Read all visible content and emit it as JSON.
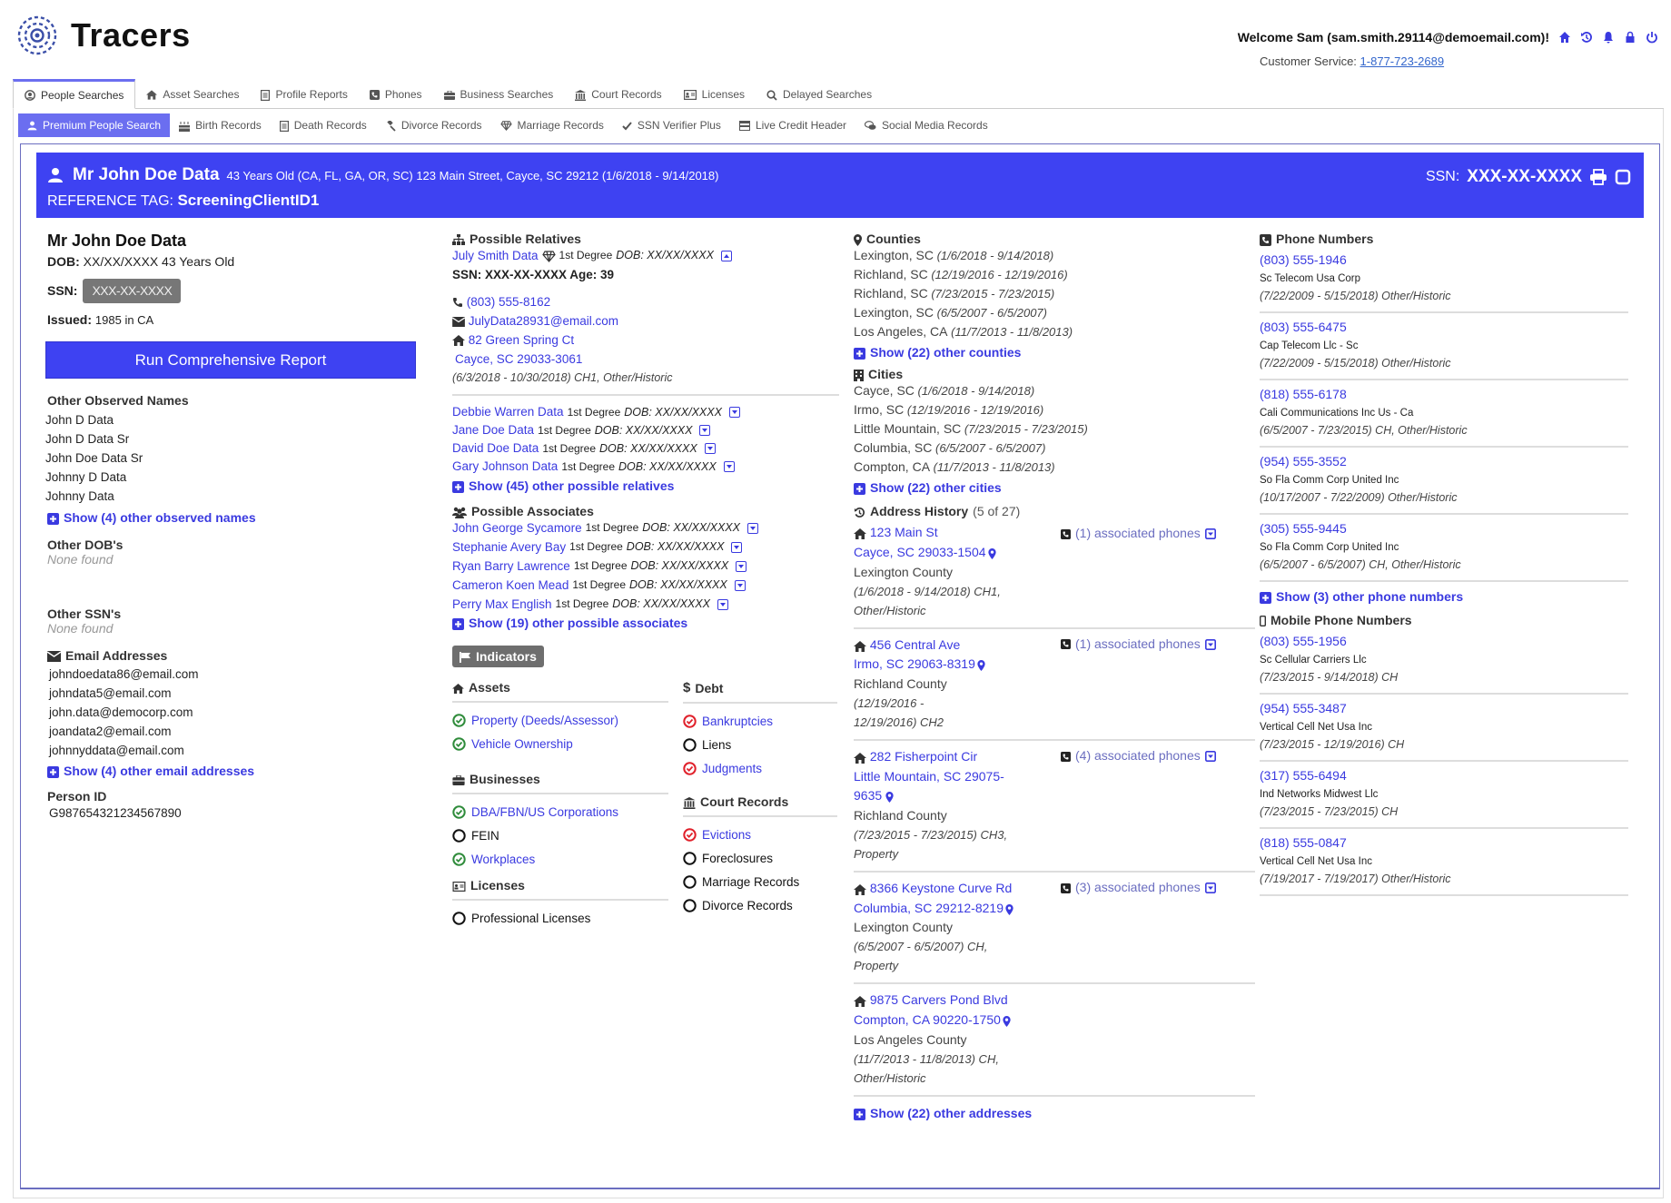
{
  "app": {
    "logo_text": "Tracers",
    "welcome": "Welcome Sam (sam.smith.29114@demoemail.com)!",
    "header_icons": [
      "home-icon",
      "history-icon",
      "bell-icon",
      "lock-icon",
      "power-icon"
    ],
    "customer_service_label": "Customer Service:",
    "customer_service_phone": "1-877-723-2689",
    "accent_color": "#3e42f2"
  },
  "tabs": [
    {
      "label": "People Searches",
      "icon": "user-circle-icon",
      "active": true
    },
    {
      "label": "Asset Searches",
      "icon": "home-icon"
    },
    {
      "label": "Profile Reports",
      "icon": "document-icon"
    },
    {
      "label": "Phones",
      "icon": "phone-square-icon"
    },
    {
      "label": "Business Searches",
      "icon": "briefcase-icon"
    },
    {
      "label": "Court Records",
      "icon": "bank-icon"
    },
    {
      "label": "Licenses",
      "icon": "id-card-icon"
    },
    {
      "label": "Delayed Searches",
      "icon": "search-icon"
    }
  ],
  "subtabs": [
    {
      "label": "Premium People Search",
      "icon": "user-icon",
      "active": true
    },
    {
      "label": "Birth Records",
      "icon": "birthday-cake-icon"
    },
    {
      "label": "Death Records",
      "icon": "document-icon"
    },
    {
      "label": "Divorce Records",
      "icon": "gavel-icon"
    },
    {
      "label": "Marriage Records",
      "icon": "diamond-icon"
    },
    {
      "label": "SSN Verifier Plus",
      "icon": "check-icon"
    },
    {
      "label": "Live Credit Header",
      "icon": "credit-card-icon"
    },
    {
      "label": "Social Media Records",
      "icon": "comments-icon"
    }
  ],
  "banner": {
    "name": "Mr John Doe Data",
    "summary": "43 Years Old (CA, FL, GA, OR, SC) 123 Main Street, Cayce, SC 29212 (1/6/2018 - 9/14/2018)",
    "ref_label": "REFERENCE TAG:",
    "ref_value": "ScreeningClientID1",
    "ssn_label": "SSN:",
    "ssn_value": "XXX-XX-XXXX"
  },
  "person": {
    "name": "Mr John Doe Data",
    "dob_label": "DOB:",
    "dob_value": "XX/XX/XXXX 43 Years Old",
    "ssn_label": "SSN:",
    "ssn_value": "XXX-XX-XXXX",
    "issued_label": "Issued:",
    "issued_value": "1985 in CA",
    "run_report_label": "Run Comprehensive Report",
    "other_names_title": "Other Observed Names",
    "other_names": [
      "John D Data",
      "John D Data Sr",
      "John Doe Data Sr",
      "Johnny D Data",
      "Johnny Data"
    ],
    "show_names": "Show (4) other observed names",
    "other_dobs_title": "Other DOB's",
    "other_dobs_value": "None found",
    "other_ssns_title": "Other SSN's",
    "other_ssns_value": "None found",
    "emails_title": "Email Addresses",
    "emails": [
      "johndoedata86@email.com",
      "johndata5@email.com",
      "john.data@democorp.com",
      "joandata2@email.com",
      "johnnyddata@email.com"
    ],
    "show_emails": "Show (4) other email addresses",
    "person_id_title": "Person ID",
    "person_id": "G987654321234567890"
  },
  "relatives": {
    "title": "Possible Relatives",
    "expanded": {
      "name": "July Smith Data",
      "degree": "1st Degree",
      "dob_label": "DOB:",
      "dob_value": "XX/XX/XXXX",
      "ssn_age": "SSN: XXX-XX-XXXX Age: 39",
      "phone": "(803) 555-8162",
      "email": "JulyData28931@email.com",
      "street": "82 Green Spring Ct",
      "city": "Cayce, SC 29033-3061",
      "dates": "(6/3/2018 - 10/30/2018) CH1, Other/Historic"
    },
    "items": [
      {
        "name": "Debbie Warren Data",
        "degree": "1st Degree",
        "dob_label": "DOB:",
        "dob_value": "XX/XX/XXXX"
      },
      {
        "name": "Jane Doe Data",
        "degree": "1st Degree",
        "dob_label": "DOB:",
        "dob_value": "XX/XX/XXXX"
      },
      {
        "name": "David Doe Data",
        "degree": "1st Degree",
        "dob_label": "DOB:",
        "dob_value": "XX/XX/XXXX"
      },
      {
        "name": "Gary Johnson Data",
        "degree": "1st Degree",
        "dob_label": "DOB:",
        "dob_value": "XX/XX/XXXX"
      }
    ],
    "show_more": "Show (45) other possible relatives"
  },
  "associates": {
    "title": "Possible Associates",
    "items": [
      {
        "name": "John George Sycamore",
        "degree": "1st Degree",
        "dob_label": "DOB:",
        "dob_value": "XX/XX/XXXX"
      },
      {
        "name": "Stephanie Avery Bay",
        "degree": "1st Degree",
        "dob_label": "DOB:",
        "dob_value": "XX/XX/XXXX"
      },
      {
        "name": "Ryan Barry Lawrence",
        "degree": "1st Degree",
        "dob_label": "DOB:",
        "dob_value": "XX/XX/XXXX"
      },
      {
        "name": "Cameron Koen Mead",
        "degree": "1st Degree",
        "dob_label": "DOB:",
        "dob_value": "XX/XX/XXXX"
      },
      {
        "name": "Perry Max English",
        "degree": "1st Degree",
        "dob_label": "DOB:",
        "dob_value": "XX/XX/XXXX"
      }
    ],
    "show_more": "Show (19) other possible associates"
  },
  "indicators": {
    "button_label": "Indicators",
    "status_colors": {
      "found": "#2e8b3a",
      "alert": "#e0202a",
      "none": "#111111"
    },
    "assets": {
      "title": "Assets",
      "items": [
        {
          "label": "Property (Deeds/Assessor)",
          "status": "found"
        },
        {
          "label": "Vehicle Ownership",
          "status": "found"
        }
      ]
    },
    "businesses": {
      "title": "Businesses",
      "items": [
        {
          "label": "DBA/FBN/US Corporations",
          "status": "found"
        },
        {
          "label": "FEIN",
          "status": "none"
        },
        {
          "label": "Workplaces",
          "status": "found"
        }
      ]
    },
    "licenses": {
      "title": "Licenses",
      "items": [
        {
          "label": "Professional Licenses",
          "status": "none"
        }
      ]
    },
    "debt": {
      "title": "Debt",
      "items": [
        {
          "label": "Bankruptcies",
          "status": "alert"
        },
        {
          "label": "Liens",
          "status": "none"
        },
        {
          "label": "Judgments",
          "status": "alert"
        }
      ]
    },
    "court": {
      "title": "Court Records",
      "items": [
        {
          "label": "Evictions",
          "status": "alert"
        },
        {
          "label": "Foreclosures",
          "status": "none"
        },
        {
          "label": "Marriage Records",
          "status": "none"
        },
        {
          "label": "Divorce Records",
          "status": "none"
        }
      ]
    }
  },
  "counties": {
    "title": "Counties",
    "items": [
      {
        "place": "Lexington, SC",
        "dates": "(1/6/2018 - 9/14/2018)"
      },
      {
        "place": "Richland, SC",
        "dates": "(12/19/2016 - 12/19/2016)"
      },
      {
        "place": "Richland, SC",
        "dates": "(7/23/2015 - 7/23/2015)"
      },
      {
        "place": "Lexington, SC",
        "dates": "(6/5/2007 - 6/5/2007)"
      },
      {
        "place": "Los Angeles, CA",
        "dates": "(11/7/2013 - 11/8/2013)"
      }
    ],
    "show_more": "Show (22) other counties"
  },
  "cities": {
    "title": "Cities",
    "items": [
      {
        "place": "Cayce, SC",
        "dates": "(1/6/2018 - 9/14/2018)"
      },
      {
        "place": "Irmo, SC",
        "dates": "(12/19/2016 - 12/19/2016)"
      },
      {
        "place": "Little Mountain, SC",
        "dates": "(7/23/2015 - 7/23/2015)"
      },
      {
        "place": "Columbia, SC",
        "dates": "(6/5/2007 - 6/5/2007)"
      },
      {
        "place": "Compton, CA",
        "dates": "(11/7/2013 - 11/8/2013)"
      }
    ],
    "show_more": "Show (22) other cities"
  },
  "addresses": {
    "title": "Address History",
    "count": "(5 of 27)",
    "items": [
      {
        "street": "123 Main St",
        "city": "Cayce, SC 29033-1504",
        "county": "Lexington County",
        "dates": "(1/6/2018 - 9/14/2018) CH1,",
        "type": "Other/Historic",
        "phones": "(1) associated phones"
      },
      {
        "street": "456 Central Ave",
        "city": "Irmo, SC 29063-8319",
        "county": "Richland County",
        "dates": "(12/19/2016 -",
        "type": "12/19/2016) CH2",
        "phones": "(1) associated phones"
      },
      {
        "street": "282 Fisherpoint Cir",
        "city": "Little Mountain, SC 29075-",
        "city2": "9635",
        "county": "Richland County",
        "dates": "(7/23/2015 - 7/23/2015) CH3,",
        "type": "Property",
        "phones": "(4) associated phones"
      },
      {
        "street": "8366 Keystone Curve Rd",
        "city": "Columbia, SC 29212-8219",
        "county": "Lexington County",
        "dates": "(6/5/2007 - 6/5/2007) CH,",
        "type": "Property",
        "phones": "(3) associated phones"
      },
      {
        "street": "9875 Carvers Pond Blvd",
        "city": "Compton, CA 90220-1750",
        "county": "Los Angeles County",
        "dates": "(11/7/2013 - 11/8/2013) CH,",
        "type": "Other/Historic",
        "phones": null
      }
    ],
    "show_more": "Show (22) other addresses"
  },
  "phones": {
    "title": "Phone Numbers",
    "items": [
      {
        "number": "(803) 555-1946",
        "carrier": "Sc Telecom Usa Corp",
        "dates": "(7/22/2009 - 5/15/2018) Other/Historic"
      },
      {
        "number": "(803) 555-6475",
        "carrier": "Cap Telecom Llc - Sc",
        "dates": "(7/22/2009 - 5/15/2018) Other/Historic"
      },
      {
        "number": "(818) 555-6178",
        "carrier": "Cali Communications Inc Us - Ca",
        "dates": "(6/5/2007 - 7/23/2015) CH, Other/Historic"
      },
      {
        "number": "(954) 555-3552",
        "carrier": "So Fla Comm Corp United Inc",
        "dates": "(10/17/2007 - 7/22/2009) Other/Historic"
      },
      {
        "number": "(305) 555-9445",
        "carrier": "So Fla Comm Corp United Inc",
        "dates": "(6/5/2007 - 6/5/2007) CH, Other/Historic"
      }
    ],
    "show_more": "Show (3) other phone numbers"
  },
  "mobile": {
    "title": "Mobile Phone Numbers",
    "items": [
      {
        "number": "(803) 555-1956",
        "carrier": "Sc Cellular Carriers Llc",
        "dates": "(7/23/2015 - 9/14/2018) CH"
      },
      {
        "number": "(954) 555-3487",
        "carrier": "Vertical Cell Net Usa Inc",
        "dates": "(7/23/2015 - 12/19/2016) CH"
      },
      {
        "number": "(317) 555-6494",
        "carrier": "Ind Networks Midwest Llc",
        "dates": "(7/23/2015 - 7/23/2015) CH"
      },
      {
        "number": "(818) 555-0847",
        "carrier": "Vertical Cell Net Usa Inc",
        "dates": "(7/19/2017 - 7/19/2017) Other/Historic"
      }
    ]
  }
}
